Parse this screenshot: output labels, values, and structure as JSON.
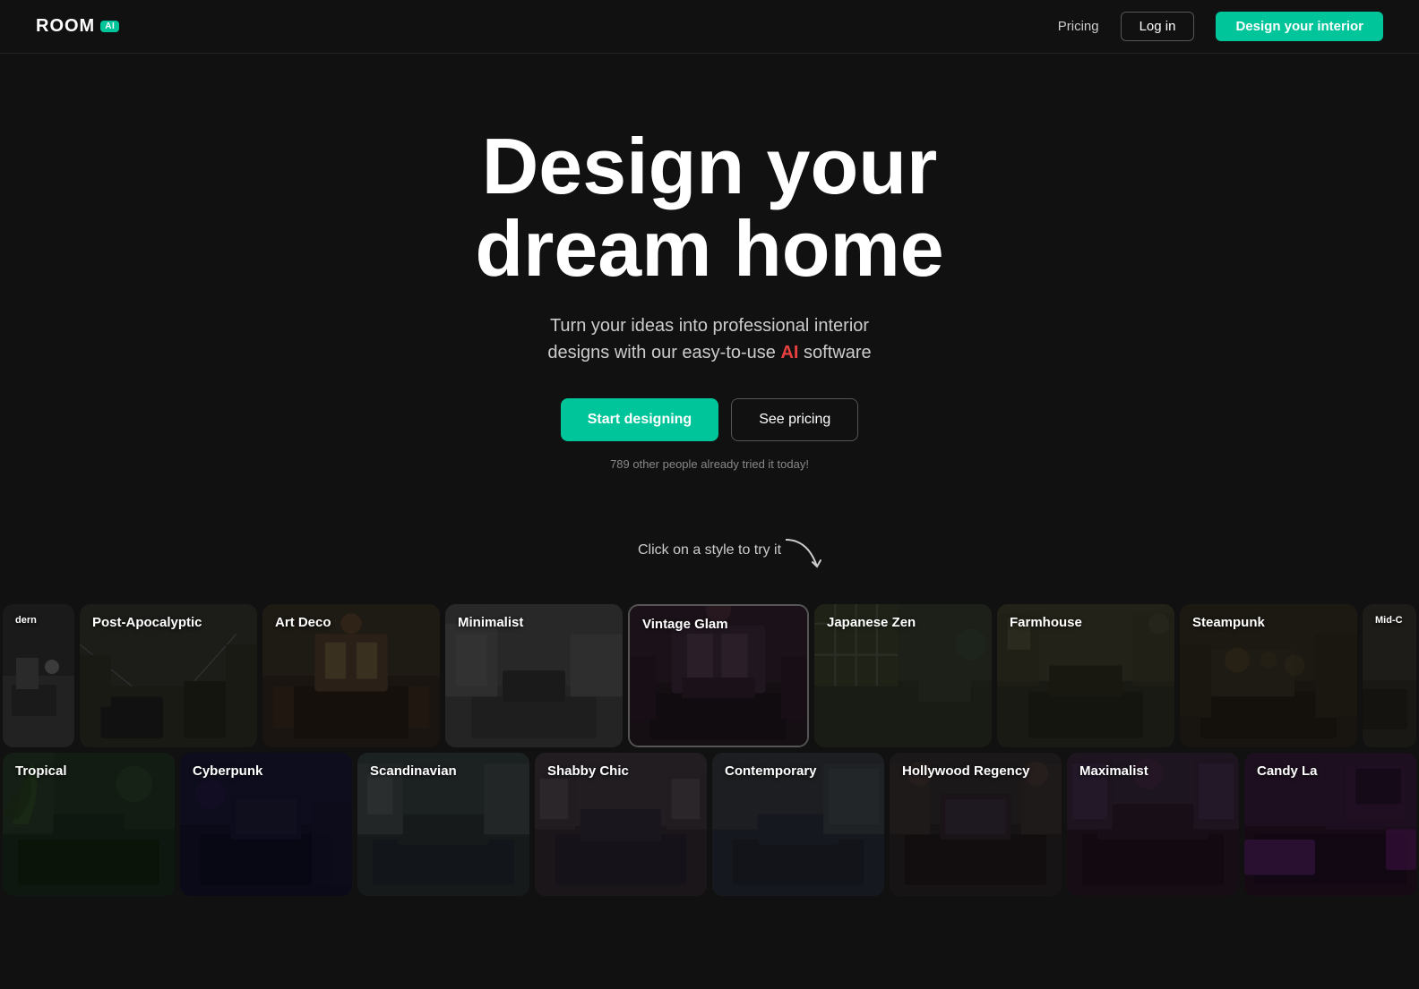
{
  "nav": {
    "logo_text": "ROOM",
    "logo_badge": "AI",
    "pricing_label": "Pricing",
    "login_label": "Log in",
    "cta_label": "Design your interior"
  },
  "hero": {
    "title_line1": "Design your",
    "title_line2": "dream home",
    "subtitle_before_ai": "Turn your ideas into professional interior\ndesigns with our easy-to-use ",
    "subtitle_ai": "AI",
    "subtitle_after_ai": " software",
    "btn_start": "Start designing",
    "btn_pricing": "See pricing",
    "note": "789 other people already tried it today!"
  },
  "styles_section": {
    "prompt": "Click on a style to try it",
    "row1": [
      {
        "label": "Modern",
        "bg": "bg-modern",
        "partial": true
      },
      {
        "label": "Post-Apocalyptic",
        "bg": "bg-postapoc"
      },
      {
        "label": "Art Deco",
        "bg": "bg-artdeco"
      },
      {
        "label": "Minimalist",
        "bg": "bg-minimalist"
      },
      {
        "label": "Vintage Glam",
        "bg": "bg-vintage"
      },
      {
        "label": "Japanese Zen",
        "bg": "bg-japanese"
      },
      {
        "label": "Farmhouse",
        "bg": "bg-farmhouse"
      },
      {
        "label": "Steampunk",
        "bg": "bg-steampunk"
      },
      {
        "label": "Mid-C",
        "bg": "bg-midcentury",
        "partial": true
      }
    ],
    "row2": [
      {
        "label": "Tropical",
        "bg": "bg-tropical"
      },
      {
        "label": "Cyberpunk",
        "bg": "bg-cyberpunk"
      },
      {
        "label": "Scandinavian",
        "bg": "bg-scandinavian"
      },
      {
        "label": "Shabby Chic",
        "bg": "bg-shabbychic"
      },
      {
        "label": "Contemporary",
        "bg": "bg-contemporary"
      },
      {
        "label": "Hollywood Regency",
        "bg": "bg-hollywood"
      },
      {
        "label": "Maximalist",
        "bg": "bg-maximalist"
      },
      {
        "label": "Candy La",
        "bg": "bg-candylal",
        "partial": true
      }
    ]
  }
}
